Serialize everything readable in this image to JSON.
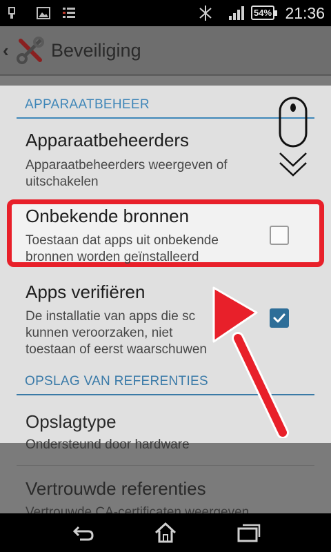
{
  "status_bar": {
    "time": "21:36",
    "battery": "54%",
    "icons": [
      "usb-icon",
      "image-icon",
      "checklist-icon",
      "bluetooth-icon",
      "signal-icon"
    ]
  },
  "action_bar": {
    "title": "Beveiliging",
    "back_icon": "chevron-left-icon",
    "app_icon": "tools-icon"
  },
  "sections": {
    "device_admin": {
      "header": "APPARAATBEHEER",
      "items": [
        {
          "title": "Apparaatbeheerders",
          "subtitle_lines": [
            "Apparaatbeheerders weergeven of",
            "uitschakelen"
          ]
        },
        {
          "title": "Onbekende bronnen",
          "subtitle_lines": [
            "Toestaan dat apps uit onbekende",
            "bronnen worden geïnstalleerd"
          ],
          "checked": false
        },
        {
          "title": "Apps verifiëren",
          "subtitle_lines": [
            "De installatie van apps die sc",
            "kunnen veroorzaken, niet",
            "toestaan of eerst waarschuwen"
          ],
          "checked": true
        }
      ]
    },
    "credential_storage": {
      "header": "OPSLAG VAN REFERENTIES",
      "items": [
        {
          "title": "Opslagtype",
          "subtitle_lines": [
            "Ondersteund door hardware"
          ]
        },
        {
          "title": "Vertrouwde referenties",
          "subtitle_lines": [
            "Vertrouwde CA-certificaten weergeven"
          ]
        }
      ]
    }
  },
  "overlay": {
    "scroll_hint_icon": "mouse-scroll-down-icon",
    "arrow_icon": "red-arrow-icon",
    "highlight_color": "#e8202a"
  },
  "nav_bar": {
    "icons": [
      "back-nav-icon",
      "home-nav-icon",
      "recents-nav-icon"
    ]
  }
}
